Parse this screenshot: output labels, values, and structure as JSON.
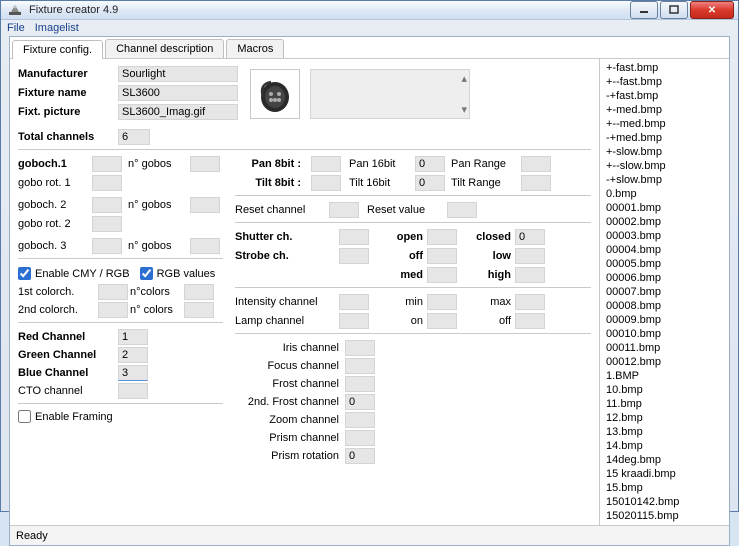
{
  "window": {
    "title": "Fixture creator 4.9"
  },
  "menu": {
    "file": "File",
    "imagelist": "Imagelist"
  },
  "tabs": {
    "config": "Fixture config.",
    "channel": "Channel description",
    "macros": "Macros"
  },
  "labels": {
    "manufacturer": "Manufacturer",
    "fixture_name": "Fixture name",
    "fixt_picture": "Fixt. picture",
    "total_channels": "Total channels",
    "goboch1": "goboch.1",
    "n_gobos": "n° gobos",
    "gobo_rot1": "gobo rot. 1",
    "goboch2": "goboch. 2",
    "gobo_rot2": "gobo rot. 2",
    "goboch3": "goboch. 3",
    "enable_cmy": "Enable CMY / RGB",
    "rgb_values": "RGB values",
    "first_colorch": "1st colorch.",
    "n_colors": "n°colors",
    "second_colorch": "2nd colorch.",
    "n_colors2": "n° colors",
    "red_channel": "Red Channel",
    "green_channel": "Green Channel",
    "blue_channel": "Blue Channel",
    "cto_channel": "CTO channel",
    "enable_framing": "Enable Framing",
    "pan8": "Pan 8bit :",
    "tilt8": "Tilt 8bit :",
    "pan16": "Pan 16bit",
    "tilt16": "Tilt 16bit",
    "pan_range": "Pan Range",
    "tilt_range": "Tilt Range",
    "reset_ch": "Reset channel",
    "reset_val": "Reset value",
    "shutter_ch": "Shutter ch.",
    "strobe_ch": "Strobe ch.",
    "open": "open",
    "closed": "closed",
    "off": "off",
    "low": "low",
    "med": "med",
    "high": "high",
    "intensity_ch": "Intensity channel",
    "lamp_ch": "Lamp channel",
    "min": "min",
    "max": "max",
    "on": "on",
    "off2": "off",
    "iris_ch": "Iris channel",
    "focus_ch": "Focus channel",
    "frost_ch": "Frost channel",
    "frost2_ch": "2nd. Frost channel",
    "zoom_ch": "Zoom channel",
    "prism_ch": "Prism channel",
    "prism_rot": "Prism rotation"
  },
  "values": {
    "manufacturer": "Sourlight",
    "fixture_name": "SL3600",
    "fixt_picture": "SL3600_Imag.gif",
    "total_channels": "6",
    "red": "1",
    "green": "2",
    "blue": "3",
    "pan16": "0",
    "tilt16": "0",
    "closed": "0",
    "frost2": "0",
    "prism_rot": "0"
  },
  "filelist": [
    "+-fast.bmp",
    "+--fast.bmp",
    "-+fast.bmp",
    "+-med.bmp",
    "+--med.bmp",
    "-+med.bmp",
    "+-slow.bmp",
    "+--slow.bmp",
    "-+slow.bmp",
    "0.bmp",
    "00001.bmp",
    "00002.bmp",
    "00003.bmp",
    "00004.bmp",
    "00005.bmp",
    "00006.bmp",
    "00007.bmp",
    "00008.bmp",
    "00009.bmp",
    "00010.bmp",
    "00011.bmp",
    "00012.bmp",
    "1.BMP",
    "10.bmp",
    "11.bmp",
    "12.bmp",
    "13.bmp",
    "14.bmp",
    "14deg.bmp",
    "15 kraadi.bmp",
    "15.bmp",
    "15010142.bmp",
    "15020115.bmp"
  ],
  "status": "Ready"
}
